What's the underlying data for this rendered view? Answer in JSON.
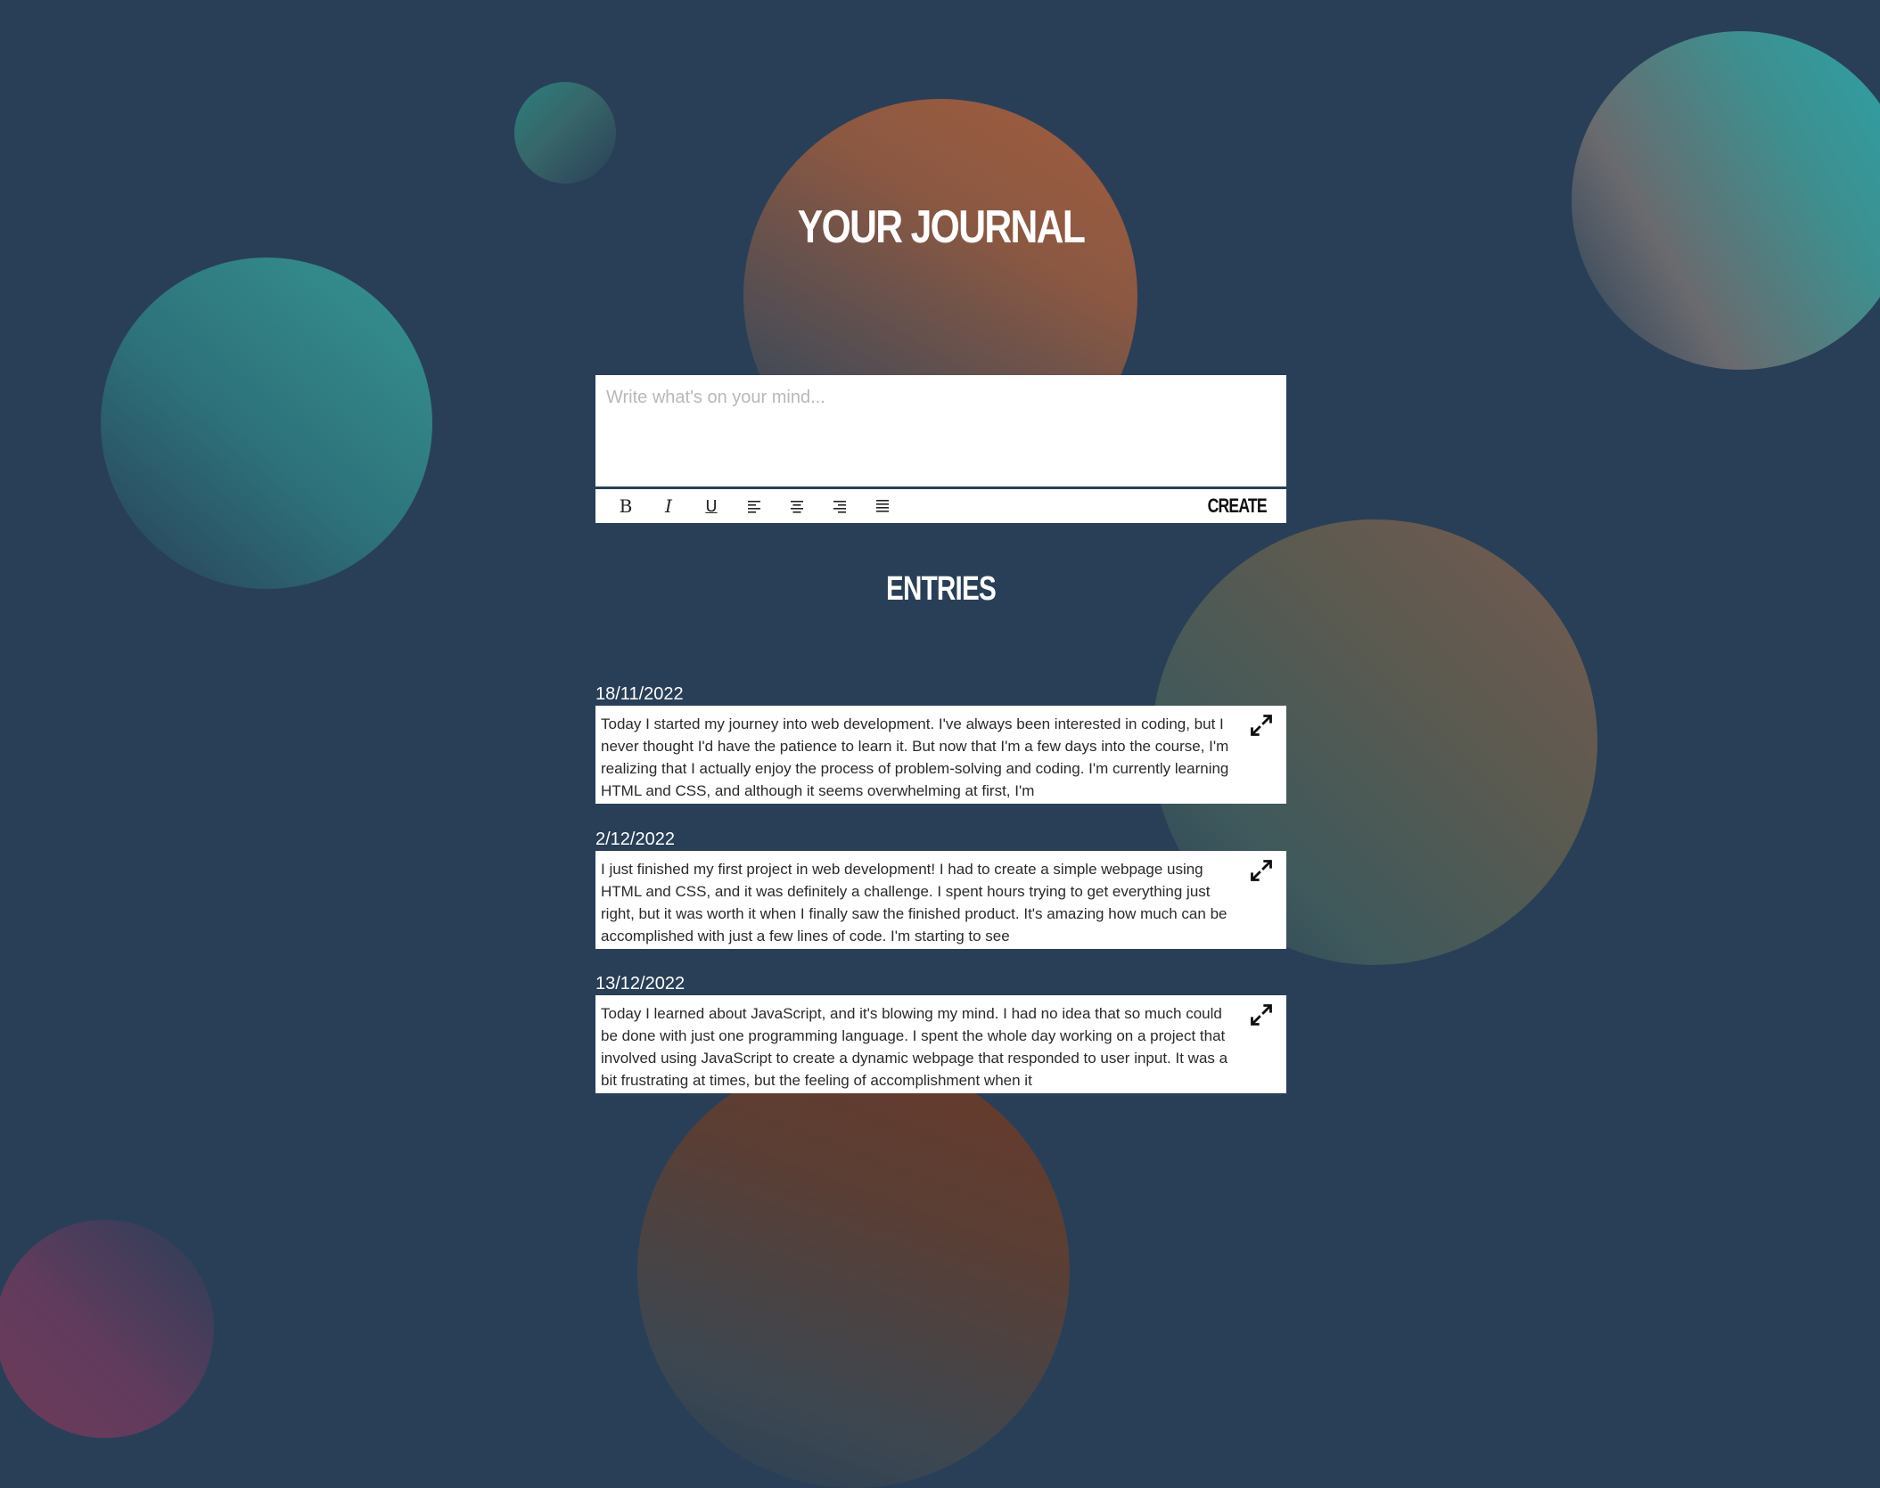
{
  "header": {
    "title": "YOUR JOURNAL"
  },
  "editor": {
    "placeholder": "Write what's on your mind...",
    "value": "",
    "toolbar": {
      "bold": "B",
      "italic": "I",
      "underline": "U",
      "icons": [
        "bold-icon",
        "italic-icon",
        "underline-icon",
        "align-left-icon",
        "align-center-icon",
        "align-right-icon",
        "align-justify-icon"
      ],
      "create_label": "CREATE"
    }
  },
  "entries": {
    "title": "ENTRIES",
    "items": [
      {
        "date": "18/11/2022",
        "text": "Today I started my journey into web development. I've always been interested in coding, but I never thought I'd have the patience to learn it. But now that I'm a few days into the course, I'm realizing that I actually enjoy the process of problem-solving and coding. I'm currently learning HTML and CSS, and although it seems overwhelming at first, I'm"
      },
      {
        "date": "2/12/2022",
        "text": "I just finished my first project in web development! I had to create a simple webpage using HTML and CSS, and it was definitely a challenge. I spent hours trying to get everything just right, but it was worth it when I finally saw the finished product. It's amazing how much can be accomplished with just a few lines of code. I'm starting to see"
      },
      {
        "date": "13/12/2022",
        "text": "Today I learned about JavaScript, and it's blowing my mind. I had no idea that so much could be done with just one programming language. I spent the whole day working on a project that involved using JavaScript to create a dynamic webpage that responded to user input. It was a bit frustrating at times, but the feeling of accomplishment when it"
      }
    ]
  },
  "colors": {
    "background": "#293f57",
    "card": "#ffffff",
    "text": "#2a2a2a"
  }
}
